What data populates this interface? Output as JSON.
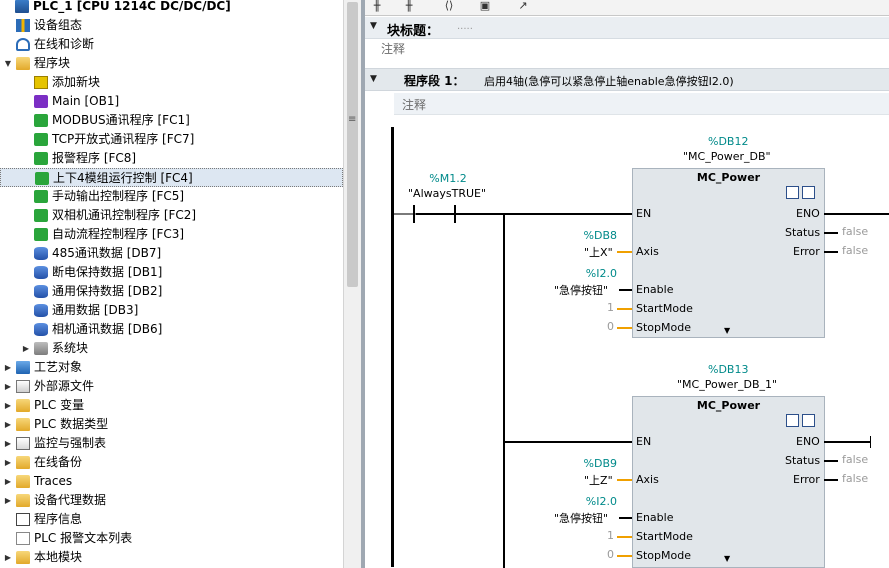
{
  "tree": {
    "items": [
      {
        "label": "PLC_1 [CPU 1214C DC/DC/DC]",
        "icon": "plc-icon",
        "indent": 0,
        "expander": "",
        "top": true
      },
      {
        "label": "设备组态",
        "icon": "device-config-icon",
        "indent": 1,
        "expander": ""
      },
      {
        "label": "在线和诊断",
        "icon": "online-diagnostics-icon",
        "indent": 1,
        "expander": ""
      },
      {
        "label": "程序块",
        "icon": "folder-icon",
        "indent": 1,
        "expander": "▼"
      },
      {
        "label": "添加新块",
        "icon": "add-block-icon",
        "indent": 2,
        "expander": ""
      },
      {
        "label": "Main [OB1]",
        "icon": "ob-block-icon",
        "indent": 2,
        "expander": ""
      },
      {
        "label": "MODBUS通讯程序 [FC1]",
        "icon": "fc-block-icon",
        "indent": 2,
        "expander": ""
      },
      {
        "label": "TCP开放式通讯程序 [FC7]",
        "icon": "fc-block-icon",
        "indent": 2,
        "expander": ""
      },
      {
        "label": "报警程序 [FC8]",
        "icon": "fc-block-icon",
        "indent": 2,
        "expander": ""
      },
      {
        "label": "上下4模组运行控制 [FC4]",
        "icon": "fc-block-icon",
        "indent": 2,
        "expander": "",
        "selected": true
      },
      {
        "label": "手动输出控制程序 [FC5]",
        "icon": "fc-block-icon",
        "indent": 2,
        "expander": ""
      },
      {
        "label": "双相机通讯控制程序 [FC2]",
        "icon": "fc-block-icon",
        "indent": 2,
        "expander": ""
      },
      {
        "label": "自动流程控制程序 [FC3]",
        "icon": "fc-block-icon",
        "indent": 2,
        "expander": ""
      },
      {
        "label": "485通讯数据 [DB7]",
        "icon": "db-block-icon",
        "indent": 2,
        "expander": ""
      },
      {
        "label": "断电保持数据 [DB1]",
        "icon": "db-block-icon",
        "indent": 2,
        "expander": ""
      },
      {
        "label": "通用保持数据 [DB2]",
        "icon": "db-block-icon",
        "indent": 2,
        "expander": ""
      },
      {
        "label": "通用数据 [DB3]",
        "icon": "db-block-icon",
        "indent": 2,
        "expander": ""
      },
      {
        "label": "相机通讯数据 [DB6]",
        "icon": "db-block-icon",
        "indent": 2,
        "expander": ""
      },
      {
        "label": "系统块",
        "icon": "system-blocks-icon",
        "indent": 2,
        "expander": "▶"
      },
      {
        "label": "工艺对象",
        "icon": "technology-objects-icon",
        "indent": 1,
        "expander": "▶"
      },
      {
        "label": "外部源文件",
        "icon": "external-source-icon",
        "indent": 1,
        "expander": "▶"
      },
      {
        "label": "PLC 变量",
        "icon": "folder-icon",
        "indent": 1,
        "expander": "▶"
      },
      {
        "label": "PLC 数据类型",
        "icon": "folder-icon",
        "indent": 1,
        "expander": "▶"
      },
      {
        "label": "监控与强制表",
        "icon": "watch-table-icon",
        "indent": 1,
        "expander": "▶"
      },
      {
        "label": "在线备份",
        "icon": "folder-icon",
        "indent": 1,
        "expander": "▶"
      },
      {
        "label": "Traces",
        "icon": "folder-icon",
        "indent": 1,
        "expander": "▶"
      },
      {
        "label": "设备代理数据",
        "icon": "folder-icon",
        "indent": 1,
        "expander": "▶"
      },
      {
        "label": "程序信息",
        "icon": "program-info-icon",
        "indent": 1,
        "expander": ""
      },
      {
        "label": "PLC 报警文本列表",
        "icon": "alarm-text-icon",
        "indent": 1,
        "expander": ""
      },
      {
        "label": "本地模块",
        "icon": "folder-icon",
        "indent": 1,
        "expander": "▶"
      }
    ]
  },
  "editor": {
    "block_title_label": "块标题：",
    "block_title_value": ".....",
    "block_comment": "注释",
    "network": {
      "label": "程序段 1：",
      "title": "启用4轴(急停可以紧急停止轴enable急停按钮I2.0)",
      "comment": "注释"
    },
    "contact": {
      "address": "%M1.2",
      "name": "\"AlwaysTRUE\""
    },
    "blocks": [
      {
        "db_address": "%DB12",
        "db_name": "\"MC_Power_DB\"",
        "type": "MC_Power",
        "pin_en": "EN",
        "pin_eno": "ENO",
        "pin_status": "Status",
        "pin_error": "Error",
        "pin_axis": "Axis",
        "pin_enable": "Enable",
        "pin_startmode": "StartMode",
        "pin_stopmode": "StopMode",
        "axis_address": "%DB8",
        "axis_name": "\"上X\"",
        "enable_address": "%I2.0",
        "enable_name": "\"急停按钮\"",
        "startmode_value": "1",
        "stopmode_value": "0",
        "status_value": "false",
        "error_value": "false"
      },
      {
        "db_address": "%DB13",
        "db_name": "\"MC_Power_DB_1\"",
        "type": "MC_Power",
        "pin_en": "EN",
        "pin_eno": "ENO",
        "pin_status": "Status",
        "pin_error": "Error",
        "pin_axis": "Axis",
        "pin_enable": "Enable",
        "pin_startmode": "StartMode",
        "pin_stopmode": "StopMode",
        "axis_address": "%DB9",
        "axis_name": "\"上Z\"",
        "enable_address": "%I2.0",
        "enable_name": "\"急停按钮\"",
        "startmode_value": "1",
        "stopmode_value": "0",
        "status_value": "false",
        "error_value": "false"
      }
    ]
  },
  "colors": {
    "accent": "#008a8a",
    "selection": "#dde7f2",
    "block_fill": "#e1e6ea",
    "wire": "#000000",
    "orange_wire": "#f0a000"
  }
}
